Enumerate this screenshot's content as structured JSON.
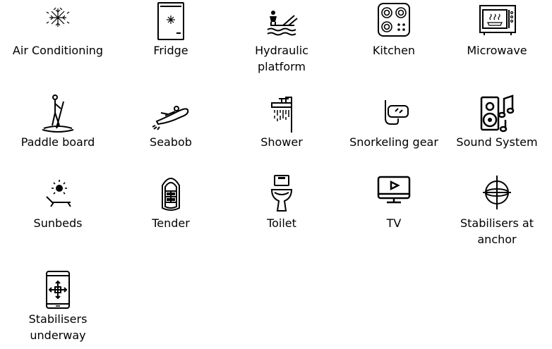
{
  "amenities": [
    {
      "label": "Air Conditioning",
      "icon": "snowflake-icon"
    },
    {
      "label": "Fridge",
      "icon": "fridge-icon"
    },
    {
      "label": "Hydraulic\nplatform",
      "icon": "hydraulic-platform-icon"
    },
    {
      "label": "Kitchen",
      "icon": "stovetop-icon"
    },
    {
      "label": "Microwave",
      "icon": "microwave-icon"
    },
    {
      "label": "Paddle board",
      "icon": "paddle-board-icon"
    },
    {
      "label": "Seabob",
      "icon": "seabob-icon"
    },
    {
      "label": "Shower",
      "icon": "shower-icon"
    },
    {
      "label": "Snorkeling gear",
      "icon": "snorkel-mask-icon"
    },
    {
      "label": "Sound System",
      "icon": "speaker-music-icon"
    },
    {
      "label": "Sunbeds",
      "icon": "sunbed-icon"
    },
    {
      "label": "Tender",
      "icon": "tender-boat-icon"
    },
    {
      "label": "Toilet",
      "icon": "toilet-icon"
    },
    {
      "label": "TV",
      "icon": "tv-play-icon"
    },
    {
      "label": "Stabilisers at\nanchor",
      "icon": "gyroscope-icon"
    },
    {
      "label": "Stabilisers\nunderway",
      "icon": "phone-arrows-icon"
    }
  ]
}
